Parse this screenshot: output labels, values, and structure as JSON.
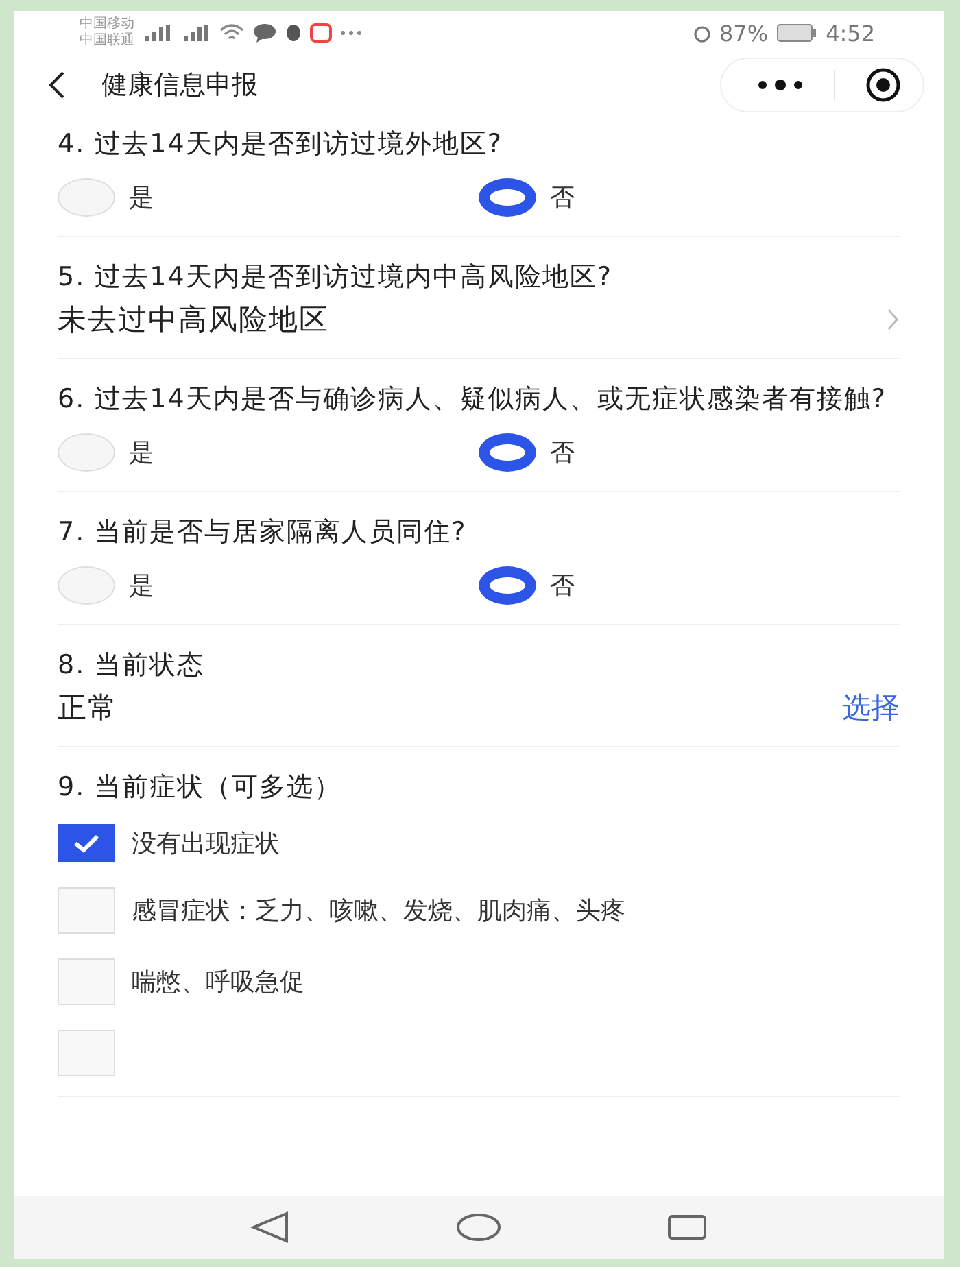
{
  "status_bar": {
    "carriers": [
      "中国移动",
      "中国联通"
    ],
    "battery_percent": "87%",
    "time": "4:52"
  },
  "nav": {
    "title": "健康信息申报"
  },
  "questions": [
    {
      "kind": "radio",
      "title": "4. 过去14天内是否到访过境外地区?",
      "options": [
        {
          "label": "是",
          "selected": false
        },
        {
          "label": "否",
          "selected": true
        }
      ]
    },
    {
      "kind": "select",
      "title": "5. 过去14天内是否到访过境内中高风险地区?",
      "value": "未去过中高风险地区"
    },
    {
      "kind": "radio",
      "title": "6. 过去14天内是否与确诊病人、疑似病人、或无症状感染者有接触?",
      "options": [
        {
          "label": "是",
          "selected": false
        },
        {
          "label": "否",
          "selected": true
        }
      ]
    },
    {
      "kind": "radio",
      "title": "7. 当前是否与居家隔离人员同住?",
      "options": [
        {
          "label": "是",
          "selected": false
        },
        {
          "label": "否",
          "selected": true
        }
      ]
    },
    {
      "kind": "choose",
      "title": "8. 当前状态",
      "value": "正常",
      "action": "选择"
    },
    {
      "kind": "checkbox",
      "title": "9. 当前症状（可多选）",
      "options": [
        {
          "label": "没有出现症状",
          "checked": true
        },
        {
          "label": "感冒症状：乏力、咳嗽、发烧、肌肉痛、头疼",
          "checked": false
        },
        {
          "label": "喘憋、呼吸急促",
          "checked": false
        },
        {
          "checked": false
        }
      ]
    }
  ]
}
